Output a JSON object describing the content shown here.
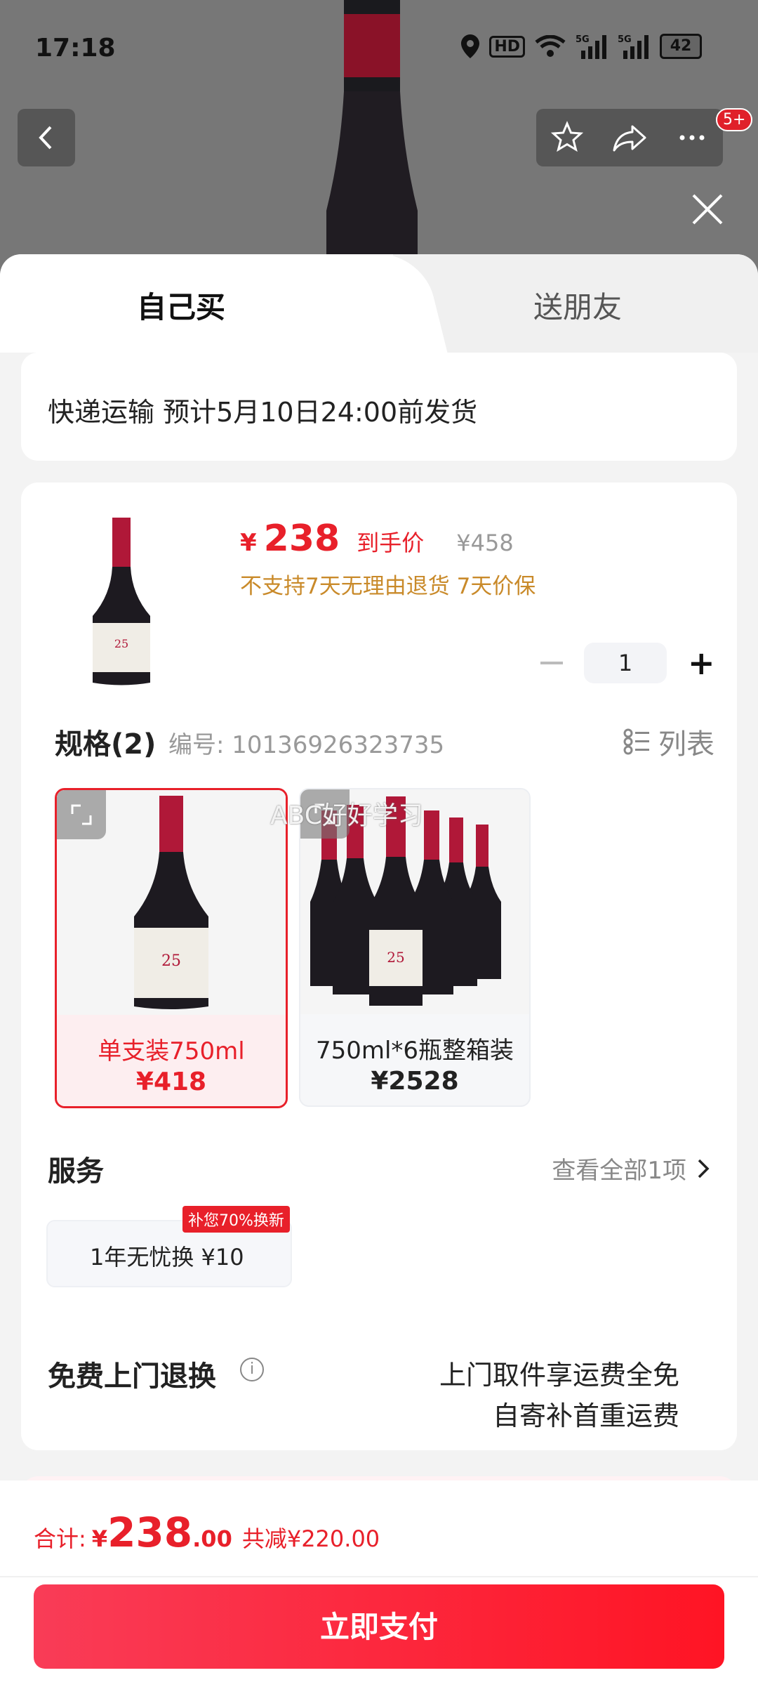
{
  "status_bar": {
    "time": "17:18",
    "battery": "42"
  },
  "top_bar": {
    "badge": "5+"
  },
  "tabs": [
    {
      "label": "自己买"
    },
    {
      "label": "送朋友"
    }
  ],
  "shipping": {
    "text": "快递运输 预计5月10日24:00前发货"
  },
  "product": {
    "price_symbol": "¥",
    "price": "238",
    "price_tag": "到手价",
    "original_price": "¥458",
    "notice": "不支持7天无理由退货  7天价保",
    "quantity": "1"
  },
  "spec": {
    "title": "规格(2)",
    "code": "编号: 10136926323735",
    "list_label": "列表",
    "options": [
      {
        "name": "单支装750ml",
        "price": "¥418"
      },
      {
        "name": "750ml*6瓶整箱装",
        "price": "¥2528"
      }
    ],
    "watermark": "ABC好好学习"
  },
  "service": {
    "title": "服务",
    "see_all": "查看全部1项",
    "chip": "1年无忧换 ¥10",
    "badge": "补您70%换新"
  },
  "return": {
    "title": "免费上门退换",
    "line1": "上门取件享运费全免",
    "line2": "自寄补首重运费"
  },
  "footer": {
    "total_label": "合计:",
    "total_symbol": "¥",
    "total_int": "238",
    "total_dec": ".00",
    "total_reduce": "共减¥220.00",
    "pay_label": "立即支付"
  },
  "colors": {
    "accent": "#e8202a",
    "notice": "#c98a2a"
  }
}
